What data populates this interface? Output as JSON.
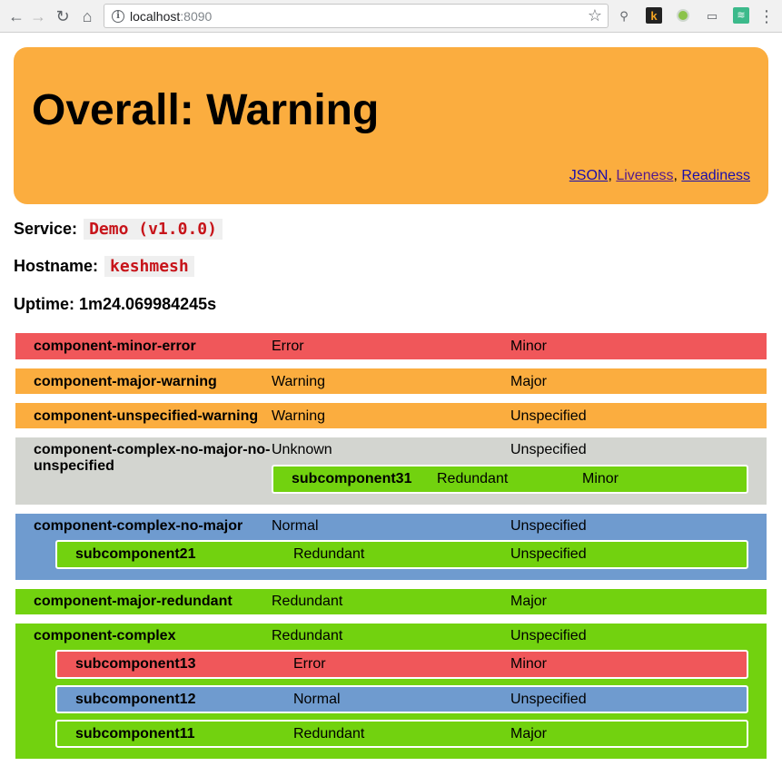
{
  "browser": {
    "url_host": "localhost",
    "url_port": ":8090",
    "colors": {
      "toolbar": "#f1f1f1"
    }
  },
  "header": {
    "title": "Overall: Warning",
    "links": [
      "JSON",
      "Liveness",
      "Readiness"
    ],
    "separator": ", "
  },
  "info": {
    "service_label": "Service:",
    "service_value": "Demo (v1.0.0)",
    "hostname_label": "Hostname:",
    "hostname_value": "keshmesh",
    "uptime_label": "Uptime:",
    "uptime_value": "1m24.069984245s"
  },
  "status_colors": {
    "Error": "#f0575a",
    "Warning": "#fbad3f",
    "Unknown": "#d3d5d0",
    "Normal": "#6f9bcf",
    "Redundant": "#72d20f"
  },
  "components": [
    {
      "name": "component-minor-error",
      "status": "Error",
      "impact": "Minor",
      "subcomponents": []
    },
    {
      "name": "component-major-warning",
      "status": "Warning",
      "impact": "Major",
      "subcomponents": []
    },
    {
      "name": "component-unspecified-warning",
      "status": "Warning",
      "impact": "Unspecified",
      "subcomponents": []
    },
    {
      "name": "component-complex-no-major-no-unspecified",
      "status": "Unknown",
      "impact": "Unspecified",
      "subcomponents": [
        {
          "name": "subcomponent31",
          "status": "Redundant",
          "impact": "Minor"
        }
      ]
    },
    {
      "name": "component-complex-no-major",
      "status": "Normal",
      "impact": "Unspecified",
      "subcomponents": [
        {
          "name": "subcomponent21",
          "status": "Redundant",
          "impact": "Unspecified"
        }
      ]
    },
    {
      "name": "component-major-redundant",
      "status": "Redundant",
      "impact": "Major",
      "subcomponents": []
    },
    {
      "name": "component-complex",
      "status": "Redundant",
      "impact": "Unspecified",
      "subcomponents": [
        {
          "name": "subcomponent13",
          "status": "Error",
          "impact": "Minor"
        },
        {
          "name": "subcomponent12",
          "status": "Normal",
          "impact": "Unspecified"
        },
        {
          "name": "subcomponent11",
          "status": "Redundant",
          "impact": "Major"
        }
      ]
    }
  ]
}
